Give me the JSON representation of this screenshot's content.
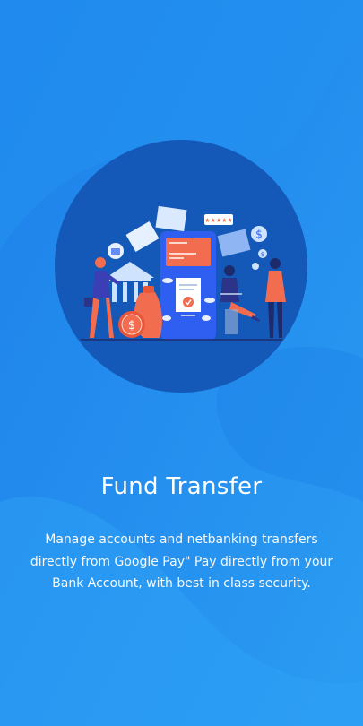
{
  "onboarding": {
    "title": "Fund Transfer",
    "description": "Manage accounts and netbanking transfers directly from Google Pay\" Pay directly from your Bank Account, with best in class security.",
    "illustration": {
      "icon": "fund-transfer-illustration",
      "rating_badge": "★★★★★"
    }
  },
  "colors": {
    "background_top": "#1e82ea",
    "background_bottom": "#2a9af2",
    "circle": "#1559b8",
    "accent_orange": "#f26d4f",
    "phone_screen": "#2e5ff0"
  }
}
